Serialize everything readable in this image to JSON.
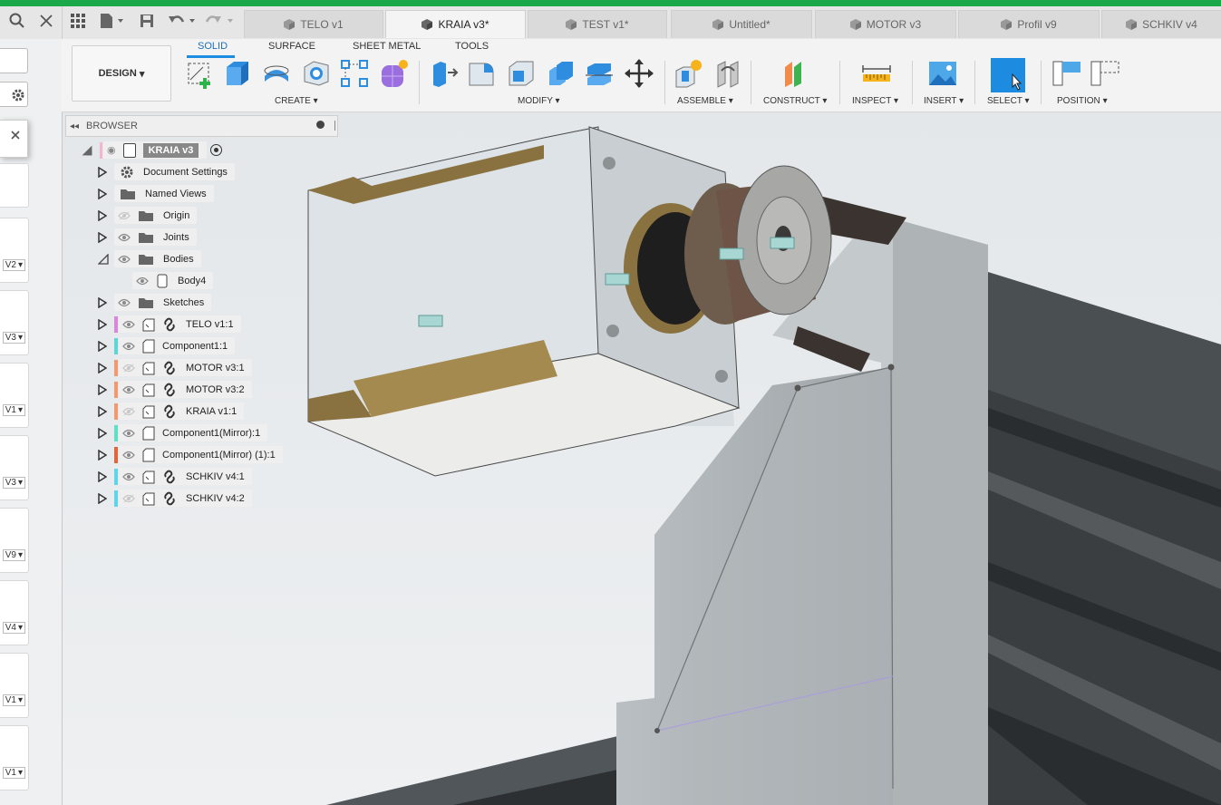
{
  "tabs": [
    {
      "label": "TELO v1",
      "active": false
    },
    {
      "label": "KRAIA v3*",
      "active": true
    },
    {
      "label": "TEST v1*",
      "active": false
    },
    {
      "label": "Untitled*",
      "active": false
    },
    {
      "label": "MOTOR v3",
      "active": false
    },
    {
      "label": "Profil v9",
      "active": false
    },
    {
      "label": "SCHKIV v4",
      "active": false
    }
  ],
  "toolbar": {
    "workspace": "DESIGN",
    "tabs": [
      "SOLID",
      "SURFACE",
      "SHEET METAL",
      "TOOLS"
    ],
    "active_tab": "SOLID",
    "groups": [
      "CREATE",
      "MODIFY",
      "ASSEMBLE",
      "CONSTRUCT",
      "INSPECT",
      "INSERT",
      "SELECT",
      "POSITION"
    ]
  },
  "left_panel": {
    "versions": [
      "V2",
      "V3",
      "V1",
      "V3",
      "V9",
      "V4",
      "V1",
      "V1"
    ]
  },
  "browser": {
    "title": "BROWSER",
    "root": "KRAIA v3",
    "items": [
      {
        "label": "Document Settings",
        "icon": "gear-icon",
        "color": ""
      },
      {
        "label": "Named Views",
        "icon": "folder-icon",
        "color": ""
      },
      {
        "label": "Origin",
        "icon": "folder-icon",
        "color": ""
      },
      {
        "label": "Joints",
        "icon": "folder-icon",
        "color": ""
      },
      {
        "label": "Bodies",
        "icon": "folder-icon",
        "color": ""
      },
      {
        "label": "Body4",
        "icon": "body-icon",
        "color": ""
      },
      {
        "label": "Sketches",
        "icon": "folder-icon",
        "color": ""
      },
      {
        "label": "TELO v1:1",
        "icon": "link-icon",
        "color": "#d987d9"
      },
      {
        "label": "Component1:1",
        "icon": "component-icon",
        "color": "#5fd6d6"
      },
      {
        "label": "MOTOR v3:1",
        "icon": "link-icon",
        "color": "#f29a6e"
      },
      {
        "label": "MOTOR v3:2",
        "icon": "link-icon",
        "color": "#f29a6e"
      },
      {
        "label": "KRAIA v1:1",
        "icon": "link-icon",
        "color": "#f29a6e"
      },
      {
        "label": "Component1(Mirror):1",
        "icon": "component-icon",
        "color": "#5fe0c4"
      },
      {
        "label": "Component1(Mirror) (1):1",
        "icon": "component-icon",
        "color": "#e0663c"
      },
      {
        "label": "SCHKIV v4:1",
        "icon": "link-icon",
        "color": "#5fd6e8"
      },
      {
        "label": "SCHKIV v4:2",
        "icon": "link-icon",
        "color": "#5fd6e8"
      }
    ]
  }
}
